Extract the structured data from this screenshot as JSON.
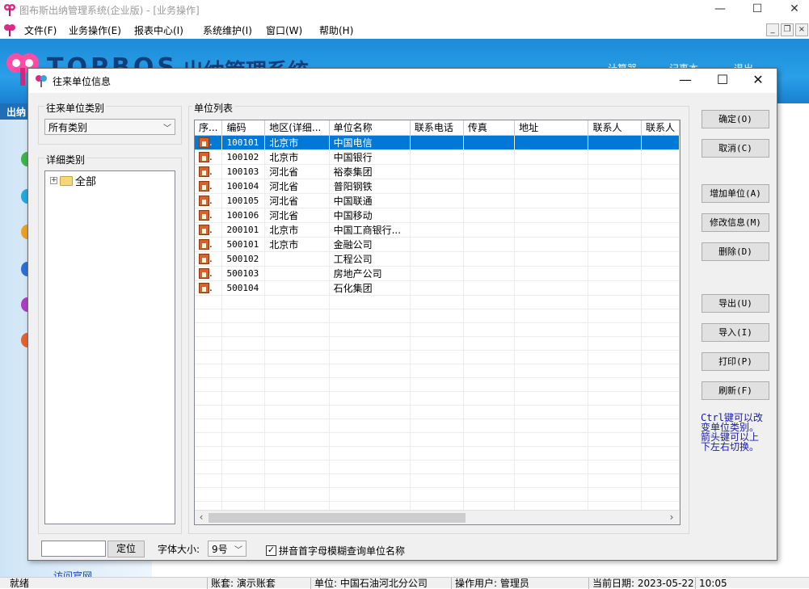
{
  "app": {
    "title": "图布斯出纳管理系统(企业版) - [业务操作]",
    "menu": [
      "文件(F)",
      "业务操作(E)",
      "报表中心(I)",
      "系统维护(I)",
      "窗口(W)",
      "帮助(H)"
    ],
    "brand": "TOPBOS",
    "brand_cn": "出纳管理系统",
    "top_links": [
      "计算器",
      "记事本",
      "",
      "退出"
    ],
    "nav_head": "出纳",
    "nav_link": "访问官网"
  },
  "dialog": {
    "title": "往来单位信息",
    "category_group_label": "往来单位类别",
    "category_selected": "所有类别",
    "detail_group_label": "详细类别",
    "tree_root": "全部",
    "list_group_label": "单位列表",
    "columns": [
      "序...",
      "编码",
      "地区(详细...",
      "单位名称",
      "联系电话",
      "传真",
      "地址",
      "联系人",
      "联系人"
    ],
    "rows": [
      {
        "seq": ".",
        "code": "100101",
        "region": "北京市",
        "name": "中国电信"
      },
      {
        "seq": ".",
        "code": "100102",
        "region": "北京市",
        "name": "中国银行"
      },
      {
        "seq": ".",
        "code": "100103",
        "region": "河北省",
        "name": "裕泰集团"
      },
      {
        "seq": ".",
        "code": "100104",
        "region": "河北省",
        "name": "普阳钢铁"
      },
      {
        "seq": ".",
        "code": "100105",
        "region": "河北省",
        "name": "中国联通"
      },
      {
        "seq": ".",
        "code": "100106",
        "region": "河北省",
        "name": "中国移动"
      },
      {
        "seq": ".",
        "code": "200101",
        "region": "北京市",
        "name": "中国工商银行..."
      },
      {
        "seq": ".",
        "code": "500101",
        "region": "北京市",
        "name": "金融公司"
      },
      {
        "seq": ".",
        "code": "500102",
        "region": "",
        "name": "工程公司"
      },
      {
        "seq": ".",
        "code": "500103",
        "region": "",
        "name": "房地产公司"
      },
      {
        "seq": ".",
        "code": "500104",
        "region": "",
        "name": "石化集团"
      }
    ],
    "buttons": {
      "ok": "确定(O)",
      "cancel": "取消(C)",
      "add": "增加单位(A)",
      "edit": "修改信息(M)",
      "delete": "删除(D)",
      "export": "导出(U)",
      "import": "导入(I)",
      "print": "打印(P)",
      "refresh": "刷新(F)"
    },
    "hint": "Ctrl键可以改变单位类别。箭头键可以上下左右切换。",
    "locate_button": "定位",
    "search_value": "",
    "font_size_label": "字体大小:",
    "font_size_value": "9号",
    "pinyin_checkbox_label": "拼音首字母模糊查询单位名称",
    "pinyin_checked": true
  },
  "status": {
    "ready": "就绪",
    "account": "账套: 演示账套",
    "unit": "单位: 中国石油河北分公司",
    "user": "操作用户: 管理员",
    "date": "当前日期: 2023-05-22",
    "time": "10:05"
  },
  "colors": {
    "selection": "#0078d7",
    "banner": "#2aa0e8",
    "hint_text": "#1a1aa8"
  }
}
